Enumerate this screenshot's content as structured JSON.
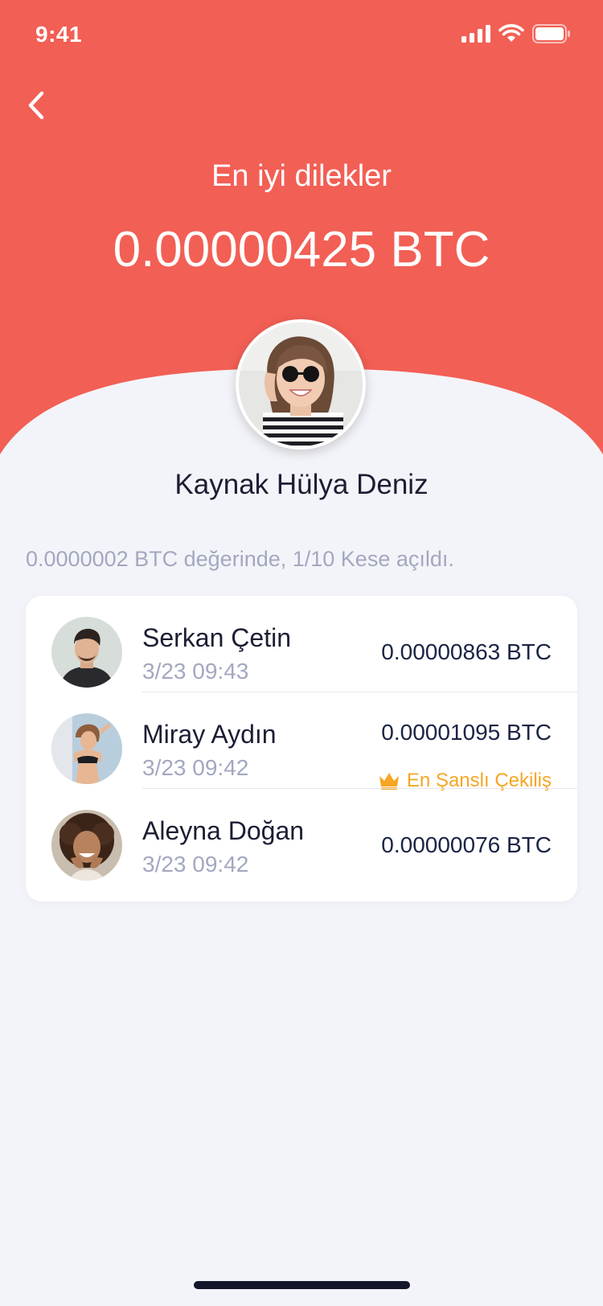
{
  "status_bar": {
    "time": "9:41"
  },
  "header": {
    "greeting": "En iyi dilekler",
    "amount": "0.00000425 BTC",
    "background_color": "#F25F55"
  },
  "sender": {
    "name": "Kaynak Hülya Deniz"
  },
  "summary": "0.0000002 BTC değerinde, 1/10 Kese açıldı.",
  "recipients": [
    {
      "name": "Serkan Çetin",
      "time": "3/23 09:43",
      "amount": "0.00000863 BTC"
    },
    {
      "name": "Miray Aydın",
      "time": "3/23 09:42",
      "amount": "0.00001095 BTC",
      "badge": "En Şanslı Çekiliş",
      "badge_icon": "crown-icon",
      "badge_color": "#F5A623"
    },
    {
      "name": "Aleyna Doğan",
      "time": "3/23 09:42",
      "amount": "0.00000076 BTC"
    }
  ],
  "colors": {
    "accent": "#F25F55",
    "background": "#F3F4F9",
    "text_primary": "#1B1E33",
    "text_secondary": "#A3A8C0",
    "gold": "#F5A623"
  }
}
